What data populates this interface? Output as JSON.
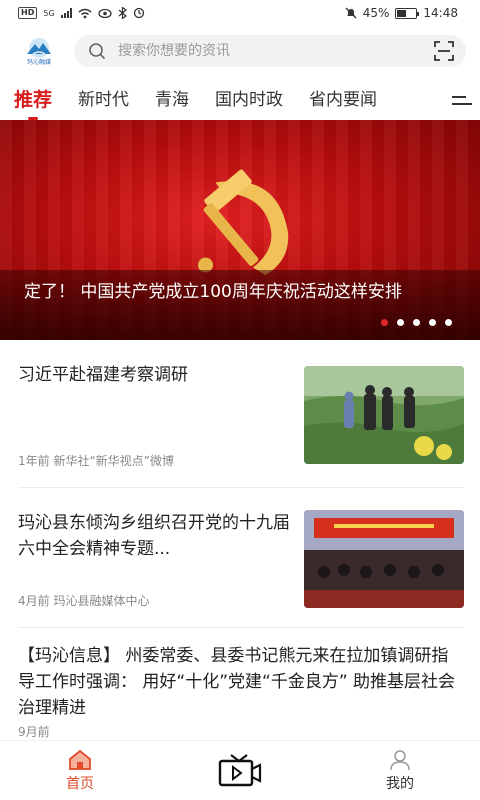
{
  "status": {
    "hd_label": "HD",
    "network": "5G",
    "battery_text": "45%",
    "battery_level": 0.45,
    "time": "14:48"
  },
  "header": {
    "logo_text": "玛沁融媒",
    "search_placeholder": "搜索你想要的资讯"
  },
  "tabs": [
    {
      "label": "推荐",
      "active": true
    },
    {
      "label": "新时代"
    },
    {
      "label": "青海"
    },
    {
      "label": "国内时政"
    },
    {
      "label": "省内要闻"
    }
  ],
  "banner": {
    "title": "定了！ 中国共产党成立100周年庆祝活动这样安排",
    "slide_count": 5,
    "active_slide": 1,
    "colors": {
      "bg": "#c01212",
      "emblem": "#f2c25a"
    }
  },
  "news": [
    {
      "title": "习近平赴福建考察调研",
      "meta": "1年前   新华社“新华视点”微博"
    },
    {
      "title": "玛沁县东倾沟乡组织召开党的十九届六中全会精神专题...",
      "meta": "4月前   玛沁县融媒体中心"
    },
    {
      "title": "【玛沁信息】 州委常委、县委书记熊元来在拉加镇调研指导工作时强调：  用好“十化”党建“千金良方” 助推基层社会治理精进",
      "meta": "9月前"
    }
  ],
  "bottom_nav": [
    {
      "label": "首页",
      "icon": "home-icon",
      "active": true
    },
    {
      "label": "",
      "icon": "video-tv-icon"
    },
    {
      "label": "我的",
      "icon": "user-icon"
    }
  ],
  "colors": {
    "accent": "#d81e1e",
    "nav_active": "#e04a2a"
  }
}
